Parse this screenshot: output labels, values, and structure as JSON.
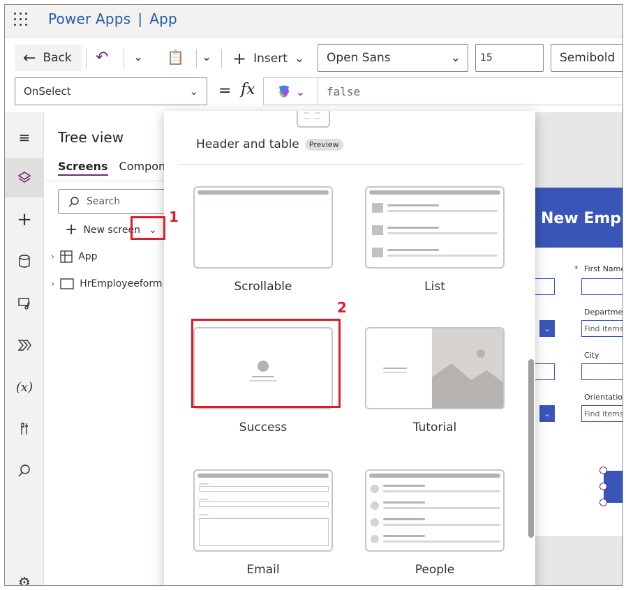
{
  "header": {
    "app_name": "Power Apps",
    "separator": "|",
    "page": "App"
  },
  "toolbar": {
    "back_label": "Back",
    "insert_label": "Insert",
    "font_family": "Open Sans",
    "font_size": "15",
    "font_weight": "Semibold"
  },
  "formula": {
    "property": "OnSelect",
    "equals": "=",
    "fx": "fx",
    "value": "false"
  },
  "tree": {
    "title": "Tree view",
    "tabs": [
      "Screens",
      "Compon"
    ],
    "search_placeholder": "Search",
    "new_screen_label": "New screen",
    "nodes": [
      "App",
      "HrEmployeeform"
    ]
  },
  "gallery": {
    "top_item": {
      "label": "Header and table",
      "badge": "Preview"
    },
    "items": [
      "Scrollable",
      "List",
      "Success",
      "Tutorial",
      "Email",
      "People"
    ]
  },
  "form_preview": {
    "title": "New Emplo",
    "required_mark": "*",
    "labels": [
      "First Name",
      "Departmen",
      "City",
      "Orientation"
    ],
    "placeholders": [
      "Find items",
      "Find items"
    ]
  },
  "annotations": {
    "marker1": "1",
    "marker2": "2",
    "color": "#d9202a"
  },
  "colors": {
    "brand": "#1f5fa8",
    "accent": "#742774",
    "form_blue": "#3955b8"
  }
}
